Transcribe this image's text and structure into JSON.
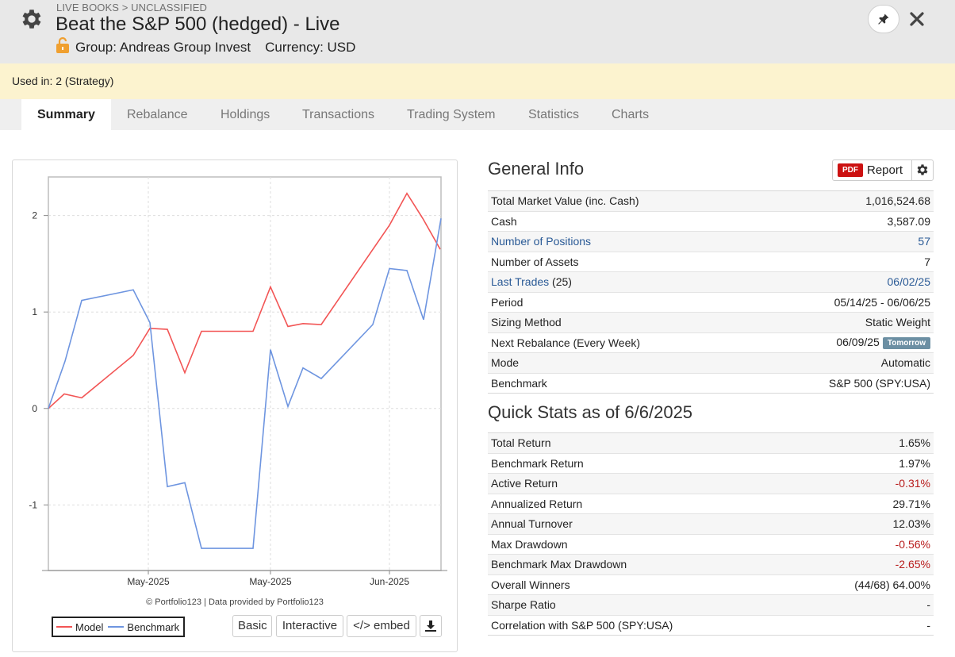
{
  "header": {
    "breadcrumb": "LIVE BOOKS > UNCLASSIFIED",
    "title": "Beat the S&P 500 (hedged) - Live",
    "group_label": "Group: Andreas Group Invest",
    "currency_label": "Currency: USD"
  },
  "used_in": "Used in: 2 (Strategy)",
  "tabs": [
    {
      "label": "Summary",
      "active": true
    },
    {
      "label": "Rebalance"
    },
    {
      "label": "Holdings"
    },
    {
      "label": "Transactions"
    },
    {
      "label": "Trading System"
    },
    {
      "label": "Statistics"
    },
    {
      "label": "Charts"
    }
  ],
  "colors": {
    "model": "#f25555",
    "benchmark": "#6e95e0",
    "negative": "#b81c1c",
    "link": "#2a5a96"
  },
  "chart_data": {
    "type": "line",
    "x_tick_labels": [
      "May-2025",
      "May-2025",
      "Jun-2025"
    ],
    "y_ticks": [
      -1,
      0,
      1,
      2
    ],
    "ylim": [
      -1.68,
      2.4
    ],
    "grid": true,
    "legend_position": "bottom-left",
    "series": [
      {
        "name": "Model",
        "values": [
          0,
          0.15,
          0.11,
          0.55,
          0.83,
          0.82,
          0.37,
          0.8,
          0.8,
          0.8,
          1.26,
          0.85,
          0.88,
          0.87,
          1.9,
          2.23,
          1.97,
          1.65
        ]
      },
      {
        "name": "Benchmark",
        "values": [
          0,
          0.49,
          1.12,
          1.23,
          0.89,
          -0.81,
          -0.77,
          -1.45,
          -1.45,
          -1.45,
          0.61,
          0.02,
          0.42,
          0.31,
          0.87,
          1.45,
          1.43,
          0.92,
          1.97
        ]
      }
    ]
  },
  "chart": {
    "credit": "© Portfolio123 | Data provided by Portfolio123",
    "legend_model": "Model",
    "legend_benchmark": "Benchmark",
    "btn_basic": "Basic",
    "btn_interactive": "Interactive",
    "btn_embed": "</> embed"
  },
  "general_info": {
    "title": "General Info",
    "report_label": "Report",
    "pdf_label": "PDF",
    "rows": [
      {
        "label": "Total Market Value (inc. Cash)",
        "value": "1,016,524.68"
      },
      {
        "label": "Cash",
        "value": "3,587.09"
      },
      {
        "label": "Number of Positions",
        "value": "57",
        "link": true
      },
      {
        "label": "Number of Assets",
        "value": "7"
      },
      {
        "label": "Last Trades",
        "label_suffix": " (25)",
        "value": "06/02/25",
        "link": true
      },
      {
        "label": "Period",
        "value": "05/14/25 - 06/06/25"
      },
      {
        "label": "Sizing Method",
        "value": "Static Weight"
      },
      {
        "label": "Next Rebalance (Every Week)",
        "value": "06/09/25",
        "badge": "Tomorrow"
      },
      {
        "label": "Mode",
        "value": "Automatic"
      },
      {
        "label": "Benchmark",
        "value": "S&P 500 (SPY:USA)"
      }
    ]
  },
  "quick_stats": {
    "title": "Quick Stats as of 6/6/2025",
    "rows": [
      {
        "label": "Total Return",
        "value": "1.65%"
      },
      {
        "label": "Benchmark Return",
        "value": "1.97%"
      },
      {
        "label": "Active Return",
        "value": "-0.31%",
        "negative": true
      },
      {
        "label": "Annualized Return",
        "value": "29.71%"
      },
      {
        "label": "Annual Turnover",
        "value": "12.03%"
      },
      {
        "label": "Max Drawdown",
        "value": "-0.56%",
        "negative": true
      },
      {
        "label": "Benchmark Max Drawdown",
        "value": "-2.65%",
        "negative": true
      },
      {
        "label": "Overall Winners",
        "value": "(44/68) 64.00%"
      },
      {
        "label": "Sharpe Ratio",
        "value": "-"
      },
      {
        "label": "Correlation with S&P 500 (SPY:USA)",
        "value": "-"
      }
    ]
  }
}
